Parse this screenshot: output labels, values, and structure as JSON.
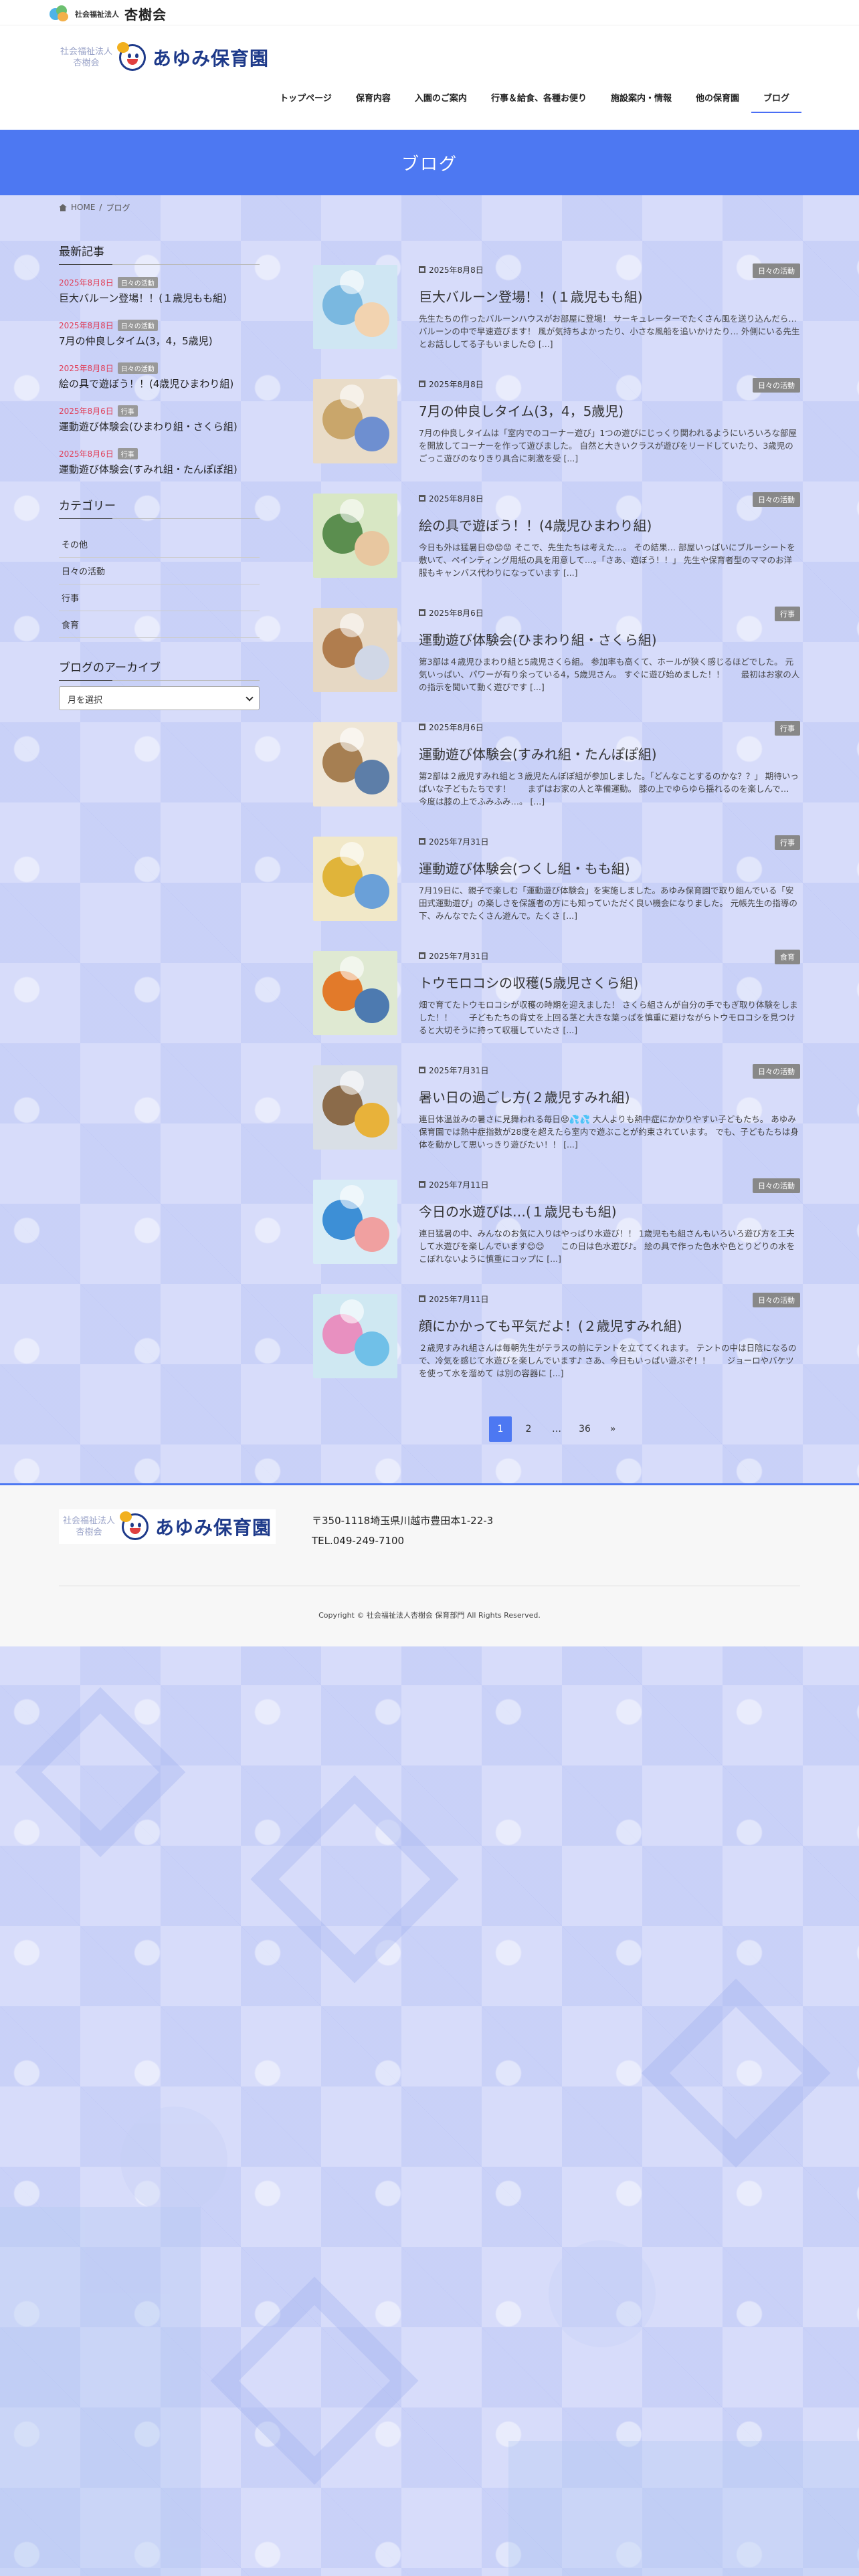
{
  "topbar": {
    "corp_small": "社会福祉法人",
    "corp_big": "杏樹会"
  },
  "header": {
    "logo_corp_line1": "社会福祉法人",
    "logo_corp_line2": "杏樹会",
    "logo_name": "あゆみ保育園"
  },
  "nav": [
    "トップページ",
    "保育内容",
    "入園のご案内",
    "行事＆給食、各種お便り",
    "施設案内・情報",
    "他の保育園",
    "ブログ"
  ],
  "banner": {
    "title": "ブログ"
  },
  "breadcrumb": {
    "home": "HOME",
    "sep": "/",
    "current": "ブログ"
  },
  "sidebar": {
    "recent_heading": "最新記事",
    "recent": [
      {
        "date": "2025年8月8日",
        "tag": "日々の活動",
        "title": "巨大バルーン登場！！(１歳児もも組)"
      },
      {
        "date": "2025年8月8日",
        "tag": "日々の活動",
        "title": "7月の仲良しタイム(3，4，5歳児)"
      },
      {
        "date": "2025年8月8日",
        "tag": "日々の活動",
        "title": "絵の具で遊ぼう！！(4歳児ひまわり組)"
      },
      {
        "date": "2025年8月6日",
        "tag": "行事",
        "title": "運動遊び体験会(ひまわり組・さくら組)"
      },
      {
        "date": "2025年8月6日",
        "tag": "行事",
        "title": "運動遊び体験会(すみれ組・たんぽぽ組)"
      }
    ],
    "category_heading": "カテゴリー",
    "categories": [
      "その他",
      "日々の活動",
      "行事",
      "食育"
    ],
    "archive_heading": "ブログのアーカイブ",
    "archive_select": "月を選択"
  },
  "posts": [
    {
      "date": "2025年8月8日",
      "category": "日々の活動",
      "title": "巨大バルーン登場！！(１歳児もも組)",
      "excerpt": "先生たちの作ったバルーンハウスがお部屋に登場！ サーキュレーターでたくさん風を送り込んだら…　バルーンの中で早速遊びます！ 風が気持ちよかったり、小さな風船を追いかけたり… 外側にいる先生とお話ししてる子もいました😊 [...]"
    },
    {
      "date": "2025年8月8日",
      "category": "日々の活動",
      "title": "7月の仲良しタイム(3，4，5歳児)",
      "excerpt": "7月の仲良しタイムは「室内でのコーナー遊び」1つの遊びにじっくり関われるようにいろいろな部屋を開放してコーナーを作って遊びました。 自然と大きいクラスが遊びをリードしていたり、3歳児のごっこ遊びのなりきり具合に刺激を受 [...]"
    },
    {
      "date": "2025年8月8日",
      "category": "日々の活動",
      "title": "絵の具で遊ぼう！！(4歳児ひまわり組)",
      "excerpt": "今日も外は猛暑日😟😟😟 そこで、先生たちは考えた…。 その結果… 部屋いっぱいにブルーシートを敷いて、ペインティング用紙の具を用意して…。「さあ、遊ぼう！！」 先生や保育者型のママのお洋服もキャンバス代わりになっています [...]"
    },
    {
      "date": "2025年8月6日",
      "category": "行事",
      "title": "運動遊び体験会(ひまわり組・さくら組)",
      "excerpt": "第3部は４歳児ひまわり組と5歳児さくら組。 参加率も高くて、ホールが狭く感じるほどでした。 元気いっぱい、パワーが有り余っている4，5歳児さん。 すぐに遊び始めました！！　　最初はお家の人の指示を聞いて動く遊びです [...]"
    },
    {
      "date": "2025年8月6日",
      "category": "行事",
      "title": "運動遊び体験会(すみれ組・たんぽぽ組)",
      "excerpt": "第2部は２歳児すみれ組と３歳児たんぽぽ組が参加しました。「どんなことするのかな？？」 期待いっぱいな子どもたちです！　　まずはお家の人と準備運動。 膝の上でゆらゆら揺れるのを楽しんで…　今度は膝の上でふみふみ…。 [...]"
    },
    {
      "date": "2025年7月31日",
      "category": "行事",
      "title": "運動遊び体験会(つくし組・もも組)",
      "excerpt": "7月19日に、親子で楽しむ「運動遊び体験会」を実施しました。あゆみ保育園で取り組んでいる「安田式運動遊び」の楽しさを保護者の方にも知っていただく良い機会になりました。 元帳先生の指導の下、みんなでたくさん遊んで。たくさ [...]"
    },
    {
      "date": "2025年7月31日",
      "category": "食育",
      "title": "トウモロコシの収穫(5歳児さくら組)",
      "excerpt": "畑で育てたトウモロコシが収穫の時期を迎えました！ さくら組さんが自分の手でもぎ取り体験をしました！！　　子どもたちの背丈を上回る茎と大きな葉っぱを慎重に避けながらトウモロコシを見つけると大切そうに持って収穫していたさ [...]"
    },
    {
      "date": "2025年7月31日",
      "category": "日々の活動",
      "title": "暑い日の過ごし方(２歳児すみれ組)",
      "excerpt": "連日体温並みの暑さに見舞われる毎日😟💦💦 大人よりも熱中症にかかりやすい子どもたち。 あゆみ保育園では熱中症指数が28度を超えたら室内で遊ぶことが約束されています。 でも、子どもたちは身体を動かして思いっきり遊びたい！！ [...]"
    },
    {
      "date": "2025年7月11日",
      "category": "日々の活動",
      "title": "今日の水遊びは…(１歳児もも組)",
      "excerpt": "連日猛暑の中、みんなのお気に入りはやっぱり水遊び！！ 1歳児もも組さんもいろいろ遊び方を工夫して水遊びを楽しんでいます😊😊　　この日は色水遊び♪。 絵の具で作った色水や色とりどりの水をこぼれないように慎重にコップに [...]"
    },
    {
      "date": "2025年7月11日",
      "category": "日々の活動",
      "title": "顔にかかっても平気だよ！(２歳児すみれ組)",
      "excerpt": "２歳児すみれ組さんは毎朝先生がテラスの前にテントを立ててくれます。 テントの中は日陰になるので、冷気を感じて水遊びを楽しんでいます♪ さあ、今日もいっぱい遊ぶぞ！！　　ジョーロやバケツを使って水を溜めて は別の容器に [...]"
    }
  ],
  "pager": {
    "current": "1",
    "next": "2",
    "ellipsis": "…",
    "last": "36",
    "arrow": "»"
  },
  "footer": {
    "address": "〒350-1118埼玉県川越市豊田本1-22-3",
    "tel": "TEL.049-249-7100",
    "copyright": "Copyright © 社会福祉法人杏樹会 保育部門 All Rights Reserved."
  },
  "colors": {
    "accent": "#4d78f2",
    "navy": "#1e3a8a",
    "date_pink": "#e0405a",
    "category_gray": "#888888"
  }
}
